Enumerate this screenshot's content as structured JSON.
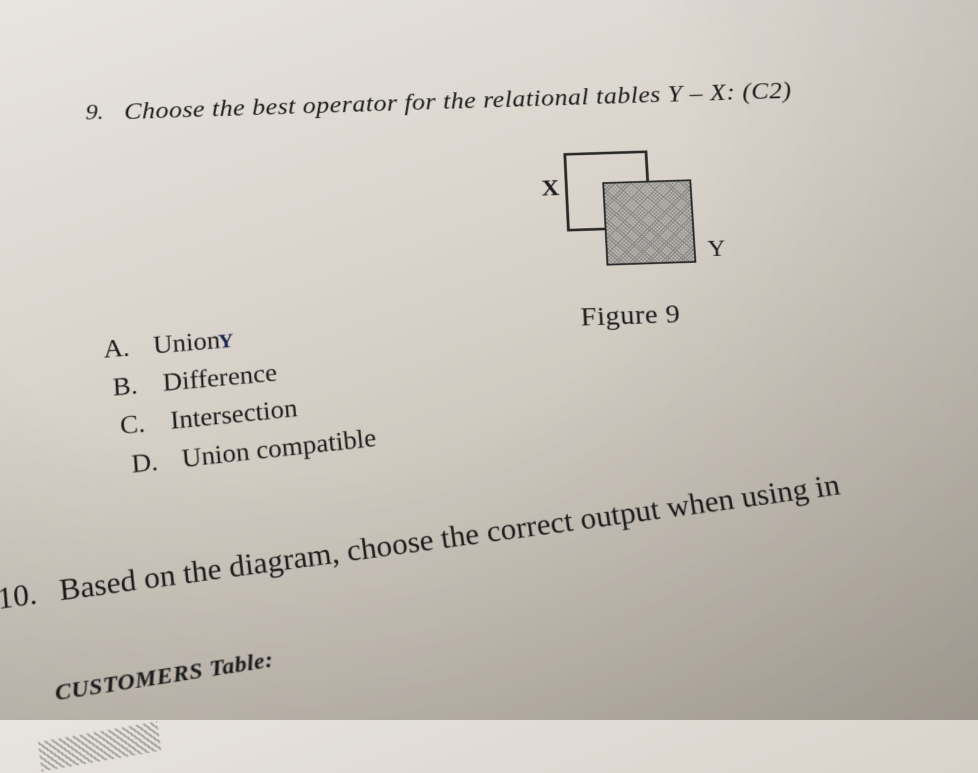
{
  "question9": {
    "number": "9.",
    "text": "Choose the best operator for the relational tables Y – X: (C2)",
    "figure_label_x": "X",
    "figure_label_y": "Y",
    "figure_caption": "Figure 9",
    "options": {
      "a": {
        "letter": "A.",
        "text": "Union",
        "annotation": "Y"
      },
      "b": {
        "letter": "B.",
        "text": "Difference"
      },
      "c": {
        "letter": "C.",
        "text": "Intersection"
      },
      "d": {
        "letter": "D.",
        "text": "Union compatible"
      }
    }
  },
  "question10": {
    "number": "10.",
    "text": "Based on the diagram, choose the correct output when using in",
    "table_heading": "CUSTOMERS Table:"
  }
}
